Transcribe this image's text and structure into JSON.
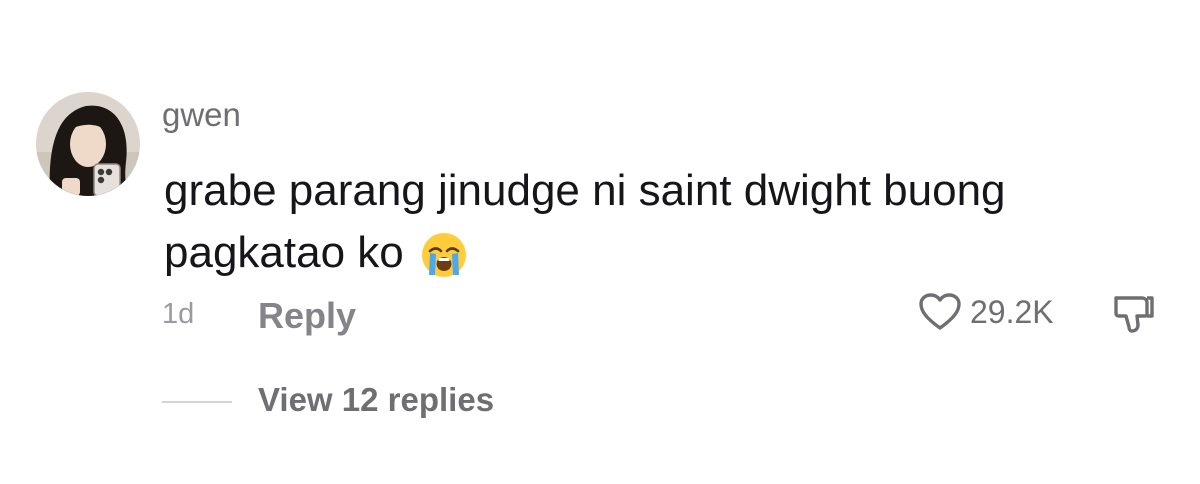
{
  "comment": {
    "username": "gwen",
    "text": "grabe parang jinudge ni saint dwight buong pagkatao ko",
    "emoji": "loudly-crying-face",
    "avatar_icon": "avatar-photo"
  },
  "meta": {
    "time": "1d",
    "reply_label": "Reply",
    "like_count": "29.2K",
    "like_icon": "heart-outline-icon",
    "dislike_icon": "thumbs-down-icon"
  },
  "replies": {
    "label": "View 12 replies"
  },
  "colors": {
    "text_primary": "#16161a",
    "text_secondary": "#6e6e73",
    "text_muted": "#9a9aa0",
    "background": "#ffffff"
  }
}
